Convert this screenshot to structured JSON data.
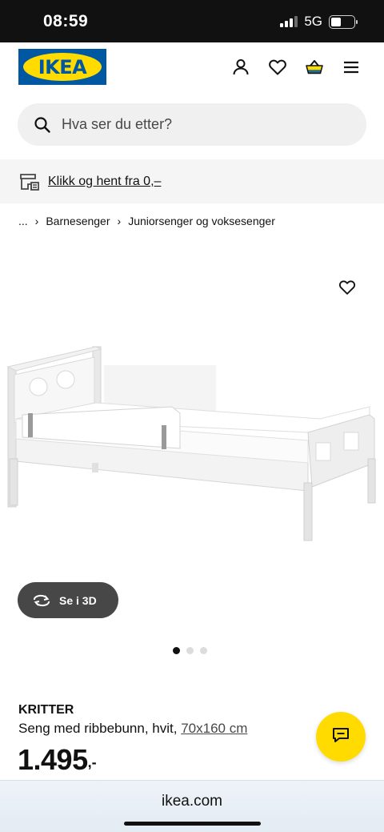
{
  "status_bar": {
    "time": "08:59",
    "network": "5G",
    "battery_percent": 45
  },
  "header": {
    "logo_text": "IKEA",
    "icons": [
      "user-icon",
      "heart-icon",
      "cart-icon",
      "menu-icon"
    ],
    "brand_colors": {
      "blue": "#0058a3",
      "yellow": "#ffdb00"
    }
  },
  "search": {
    "placeholder": "Hva ser du etter?"
  },
  "promo": {
    "text": "Klikk og hent fra 0,–"
  },
  "breadcrumb": {
    "items": [
      "...",
      "Barnesenger",
      "Juniorsenger og voksesenger"
    ]
  },
  "gallery": {
    "view_3d_label": "Se i 3D",
    "image_count": 3,
    "active_index": 0
  },
  "product": {
    "name": "KRITTER",
    "description": "Seng med ribbebunn, hvit,",
    "size": "70x160 cm",
    "price": "1.495",
    "price_suffix": ",-"
  },
  "browser": {
    "url": "ikea.com"
  }
}
